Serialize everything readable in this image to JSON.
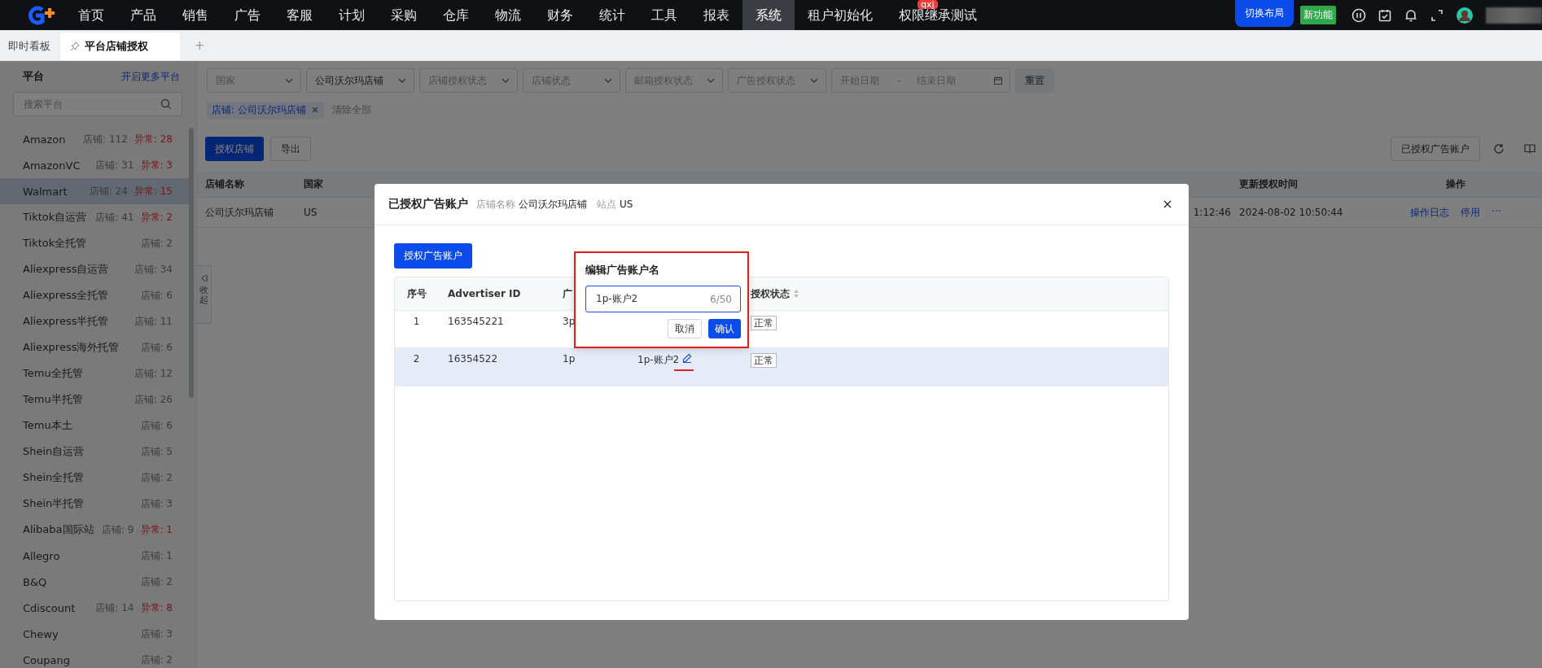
{
  "top_nav": {
    "menu": [
      {
        "label": "首页",
        "selected": false
      },
      {
        "label": "产品",
        "selected": false
      },
      {
        "label": "销售",
        "selected": false
      },
      {
        "label": "广告",
        "selected": false
      },
      {
        "label": "客服",
        "selected": false
      },
      {
        "label": "计划",
        "selected": false
      },
      {
        "label": "采购",
        "selected": false
      },
      {
        "label": "仓库",
        "selected": false
      },
      {
        "label": "物流",
        "selected": false
      },
      {
        "label": "财务",
        "selected": false
      },
      {
        "label": "统计",
        "selected": false
      },
      {
        "label": "工具",
        "selected": false
      },
      {
        "label": "报表",
        "selected": false
      },
      {
        "label": "系统",
        "selected": true
      },
      {
        "label": "租户初始化",
        "selected": false
      },
      {
        "label": "权限继承测试",
        "selected": false,
        "badge": "qxj"
      }
    ],
    "switch_layout_button": "切换布局",
    "new_feature_badge": "新功能"
  },
  "tabs": [
    {
      "label": "即时看板",
      "selected": false,
      "pinned": false
    },
    {
      "label": "平台店铺授权",
      "selected": true,
      "pinned": true
    }
  ],
  "add_tab": "+",
  "sidebar": {
    "title": "平台",
    "more_link": "开启更多平台",
    "search": {
      "placeholder": "搜索平台"
    },
    "collapse": "收起",
    "items": [
      {
        "name": "Amazon",
        "stores": "店铺: 112",
        "abnormal": "异常: 28",
        "selected": false
      },
      {
        "name": "AmazonVC",
        "stores": "店铺: 31",
        "abnormal": "异常: 3",
        "selected": false
      },
      {
        "name": "Walmart",
        "stores": "店铺: 24",
        "abnormal": "异常: 15",
        "selected": true
      },
      {
        "name": "Tiktok自运营",
        "stores": "店铺: 41",
        "abnormal": "异常: 2",
        "selected": false
      },
      {
        "name": "Tiktok全托管",
        "stores": "店铺: 2",
        "selected": false
      },
      {
        "name": "Aliexpress自运营",
        "stores": "店铺: 34",
        "selected": false
      },
      {
        "name": "Aliexpress全托管",
        "stores": "店铺: 6",
        "selected": false
      },
      {
        "name": "Aliexpress半托管",
        "stores": "店铺: 11",
        "selected": false
      },
      {
        "name": "Aliexpress海外托管",
        "stores": "店铺: 6",
        "selected": false
      },
      {
        "name": "Temu全托管",
        "stores": "店铺: 12",
        "selected": false
      },
      {
        "name": "Temu半托管",
        "stores": "店铺: 26",
        "selected": false
      },
      {
        "name": "Temu本土",
        "stores": "店铺: 6",
        "selected": false
      },
      {
        "name": "Shein自运营",
        "stores": "店铺: 5",
        "selected": false
      },
      {
        "name": "Shein全托管",
        "stores": "店铺: 2",
        "selected": false
      },
      {
        "name": "Shein半托管",
        "stores": "店铺: 3",
        "selected": false
      },
      {
        "name": "Alibaba国际站",
        "stores": "店铺: 9",
        "abnormal": "异常: 1",
        "selected": false
      },
      {
        "name": "Allegro",
        "stores": "店铺: 1",
        "selected": false
      },
      {
        "name": "B&Q",
        "stores": "店铺: 2",
        "selected": false
      },
      {
        "name": "Cdiscount",
        "stores": "店铺: 14",
        "abnormal": "异常: 8",
        "selected": false
      },
      {
        "name": "Chewy",
        "stores": "店铺: 3",
        "selected": false
      },
      {
        "name": "Coupang",
        "stores": "店铺: 2",
        "selected": false
      }
    ]
  },
  "filters": [
    {
      "kind": "select",
      "placeholder": "国家"
    },
    {
      "kind": "select",
      "value": "公司沃尔玛店铺"
    },
    {
      "kind": "select",
      "placeholder": "店铺授权状态"
    },
    {
      "kind": "select",
      "placeholder": "店铺状态"
    },
    {
      "kind": "select",
      "placeholder": "邮箱授权状态"
    },
    {
      "kind": "select",
      "placeholder": "广告授权状态"
    },
    {
      "kind": "date_range",
      "start_placeholder": "开始日期",
      "separator": "-",
      "end_placeholder": "结束日期"
    }
  ],
  "reset_button": "重置",
  "active_filters": {
    "tags": [
      "店铺: 公司沃尔玛店铺"
    ],
    "clear_all": "清除全部"
  },
  "toolbar": {
    "authorize_store_button": "授权店铺",
    "export_button": "导出",
    "ad_accounts_button": "已授权广告账户"
  },
  "table": {
    "columns": [
      "店铺名称",
      "国家",
      "更新授权时间",
      "操作"
    ],
    "rows": [
      {
        "store": "公司沃尔玛店铺",
        "country": "US",
        "column_3": "1:12:46",
        "updated": "2024-08-02 10:50:44",
        "actions": [
          "操作日志",
          "停用",
          "···"
        ]
      }
    ]
  },
  "modal": {
    "title": "已授权广告账户",
    "store_label": "店铺名称",
    "store_name": "公司沃尔玛店铺",
    "site_label": "站点",
    "site": "US",
    "authorize_button": "授权广告账户",
    "columns": [
      "序号",
      "Advertiser ID",
      "广",
      "授权状态"
    ],
    "rows": [
      {
        "index": "1",
        "advertiser_id": "163545221",
        "type": "3p",
        "status": "正常",
        "selected": false
      },
      {
        "index": "2",
        "advertiser_id": "16354522",
        "type": "1p",
        "name": "1p-账户2",
        "status": "正常",
        "selected": true,
        "name_underlined": true
      }
    ],
    "popover": {
      "title": "编辑广告账户名",
      "value": "1p-账户2",
      "counter": "6/50",
      "cancel_button": "取消",
      "confirm_button": "确认",
      "highlighted": true
    }
  }
}
